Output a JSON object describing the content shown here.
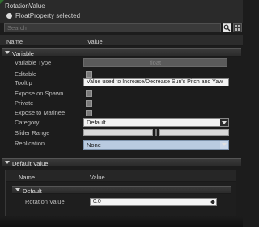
{
  "window": {
    "title": "RotationValue"
  },
  "selection": {
    "label": "FloatProperty selected"
  },
  "search": {
    "placeholder": "Search"
  },
  "columns": {
    "name": "Name",
    "value": "Value"
  },
  "variable_section": {
    "label": "Variable",
    "rows": {
      "variable_type": {
        "label": "Variable Type",
        "value": "float"
      },
      "editable": {
        "label": "Editable"
      },
      "tooltip": {
        "label": "Tooltip",
        "value": "Value used to Increase/Decrease Sun's Pitch and Yaw"
      },
      "expose_on_spawn": {
        "label": "Expose on Spawn"
      },
      "private": {
        "label": "Private"
      },
      "expose_to_matinee": {
        "label": "Expose to Matinee"
      },
      "category": {
        "label": "Category",
        "value": "Default"
      },
      "slider_range": {
        "label": "Slider Range"
      },
      "replication": {
        "label": "Replication",
        "value": "None"
      }
    }
  },
  "default_value_section": {
    "label": "Default Value",
    "columns": {
      "name": "Name",
      "value": "Value"
    },
    "sub_section": {
      "label": "Default"
    },
    "rotation_value": {
      "label": "Rotation Value",
      "value": "0.0"
    }
  },
  "colors": {
    "background": "#1c1c1c",
    "replication_highlight": "#b9cbe1",
    "tab_accent": "#2f6f2f"
  }
}
